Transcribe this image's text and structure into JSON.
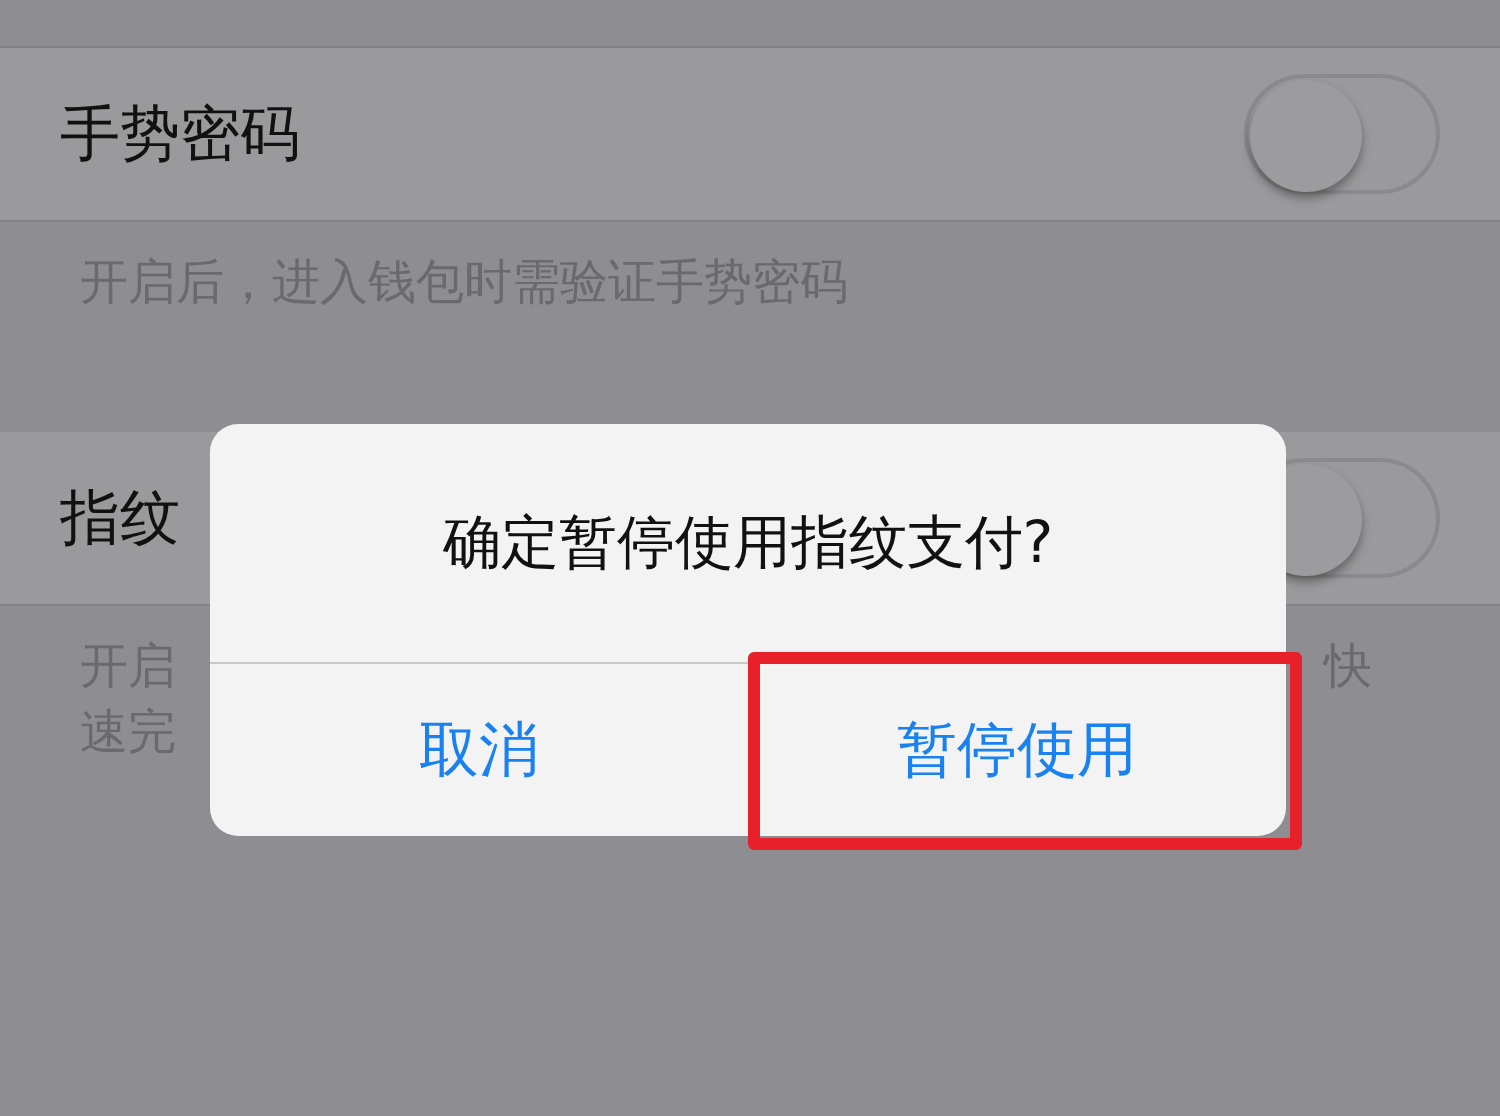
{
  "settings": [
    {
      "label": "手势密码",
      "on": false,
      "description": [
        "开启后，进入钱包时需验证手势密码"
      ]
    },
    {
      "label": "指纹",
      "on": false,
      "description_left": [
        "开启",
        "速完"
      ],
      "description_right": [
        "快"
      ]
    }
  ],
  "dialog": {
    "title": "确定暂停使用指纹支付?",
    "buttons": [
      {
        "label": "取消",
        "highlighted": false
      },
      {
        "label": "暂停使用",
        "highlighted": true
      }
    ]
  }
}
